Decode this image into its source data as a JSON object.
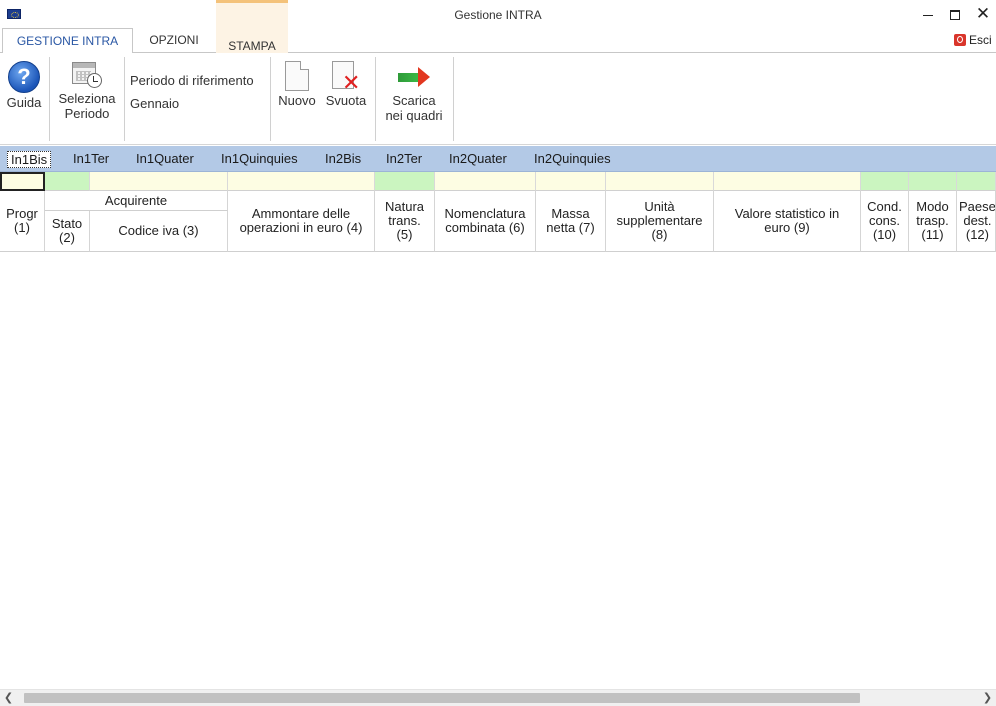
{
  "window": {
    "title": "Gestione INTRA",
    "minimize_label": "",
    "close_label": "✕"
  },
  "ribbon_tabs": [
    {
      "label": "GESTIONE INTRA"
    },
    {
      "label": "OPZIONI"
    },
    {
      "label": "STAMPA"
    }
  ],
  "esci_label": "Esci",
  "ribbon": {
    "guida": "Guida",
    "seleziona_periodo_1": "Seleziona",
    "seleziona_periodo_2": "Periodo",
    "periodo_label": "Periodo di riferimento",
    "periodo_value": "Gennaio",
    "nuovo": "Nuovo",
    "svuota": "Svuota",
    "scarica_1": "Scarica",
    "scarica_2": "nei quadri"
  },
  "sheet_tabs": [
    "In1Bis",
    "In1Ter",
    "In1Quater",
    "In1Quinquies",
    "In2Bis",
    "In2Ter",
    "In2Quater",
    "In2Quinquies"
  ],
  "active_sheet": "In1Bis",
  "grid": {
    "group_header": "Acquirente",
    "columns": {
      "progr": "Progr (1)",
      "stato": "Stato (2)",
      "codice_iva": "Codice iva (3)",
      "ammontare": "Ammontare delle operazioni in euro (4)",
      "natura": "Natura trans. (5)",
      "nomenclatura": "Nomenclatura combinata (6)",
      "massa": "Massa netta (7)",
      "unita": "Unità supplementare (8)",
      "valore": "Valore statistico in euro (9)",
      "cond": "Cond. cons. (10)",
      "modo": "Modo trasp. (11)",
      "paese": "Paese dest. (12)"
    }
  },
  "colors": {
    "sheetbar": "#b3c9e6",
    "input_yellow": "#fdfde3",
    "input_green": "#cbf5c0",
    "ribbon_accent": "#2a57a4"
  },
  "icons": [
    "app-icon",
    "help-icon",
    "calendar-icon",
    "new-doc-icon",
    "delete-doc-icon",
    "download-arrow-icon",
    "exit-icon"
  ]
}
